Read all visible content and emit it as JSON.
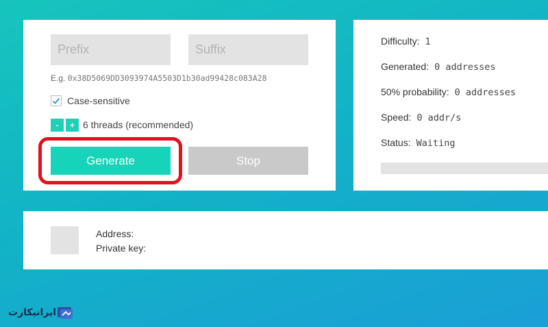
{
  "form": {
    "prefix_placeholder": "Prefix",
    "suffix_placeholder": "Suffix",
    "example_prefix": "E.g.",
    "example_address": "0x38D5069DD3093974A5503D1b30ad99428c083A28",
    "case_sensitive_label": "Case-sensitive",
    "case_sensitive_checked": true,
    "minus_label": "-",
    "plus_label": "+",
    "threads_label": "6 threads (recommended)",
    "generate_label": "Generate",
    "stop_label": "Stop"
  },
  "stats": {
    "difficulty_label": "Difficulty:",
    "difficulty_value": "1",
    "generated_label": "Generated:",
    "generated_value": "0 addresses",
    "probability_label": "50% probability:",
    "probability_value": "0 addresses",
    "speed_label": "Speed:",
    "speed_value": "0 addr/s",
    "status_label": "Status:",
    "status_value": "Waiting",
    "progress_percent": 0
  },
  "result": {
    "address_label": "Address:",
    "private_key_label": "Private key:"
  },
  "watermark": {
    "text": "ایرانیکارت"
  },
  "colors": {
    "accent": "#17d3b9",
    "stop_button": "#c9c9c9",
    "highlight": "#e3101e",
    "input_bg": "#e3e3e3"
  },
  "icons": {
    "checkbox": "check-icon",
    "watermark": "card-logo-icon"
  }
}
